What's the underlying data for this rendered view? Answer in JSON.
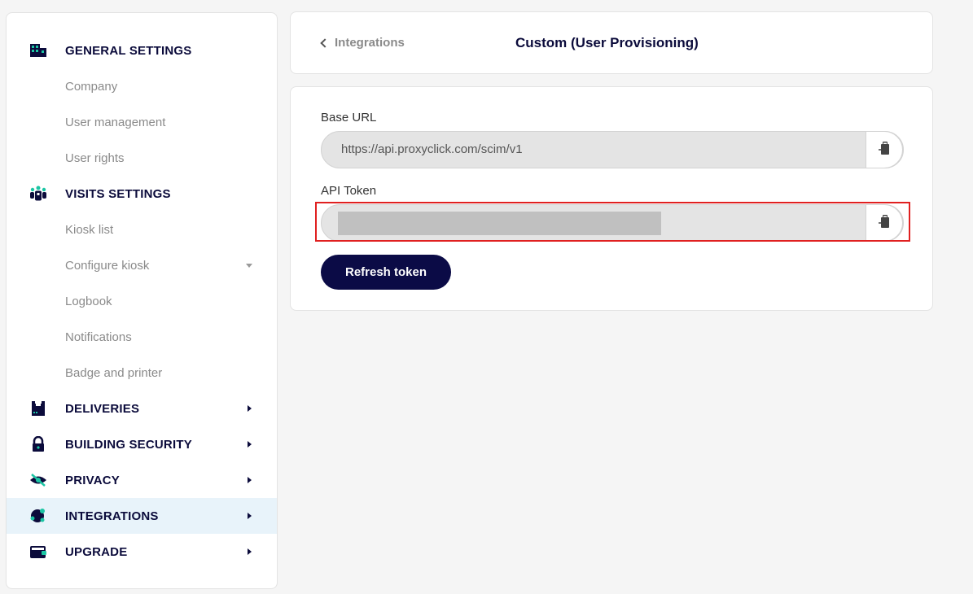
{
  "sidebar": {
    "general_settings": "GENERAL SETTINGS",
    "company": "Company",
    "user_management": "User management",
    "user_rights": "User rights",
    "visits_settings": "VISITS SETTINGS",
    "kiosk_list": "Kiosk list",
    "configure_kiosk": "Configure kiosk",
    "logbook": "Logbook",
    "notifications": "Notifications",
    "badge_and_printer": "Badge and printer",
    "deliveries": "DELIVERIES",
    "building_security": "BUILDING SECURITY",
    "privacy": "PRIVACY",
    "integrations": "INTEGRATIONS",
    "upgrade": "UPGRADE",
    "active_item": "INTEGRATIONS"
  },
  "header": {
    "back_label": "Integrations",
    "title": "Custom (User Provisioning)"
  },
  "form": {
    "base_url_label": "Base URL",
    "base_url_value": "https://api.proxyclick.com/scim/v1",
    "api_token_label": "API Token",
    "refresh_button": "Refresh token"
  },
  "colors": {
    "accent": "#0b0b46",
    "icon_teal": "#1bc5a4",
    "active_bg": "#e8f3fa",
    "highlight": "#e02020"
  },
  "icons": {
    "general_settings": "building-icon",
    "visits_settings": "people-icon",
    "deliveries": "package-icon",
    "building_security": "lock-icon",
    "privacy": "eye-slash-icon",
    "integrations": "puzzle-icon",
    "upgrade": "wallet-icon",
    "copy": "clipboard-icon"
  }
}
